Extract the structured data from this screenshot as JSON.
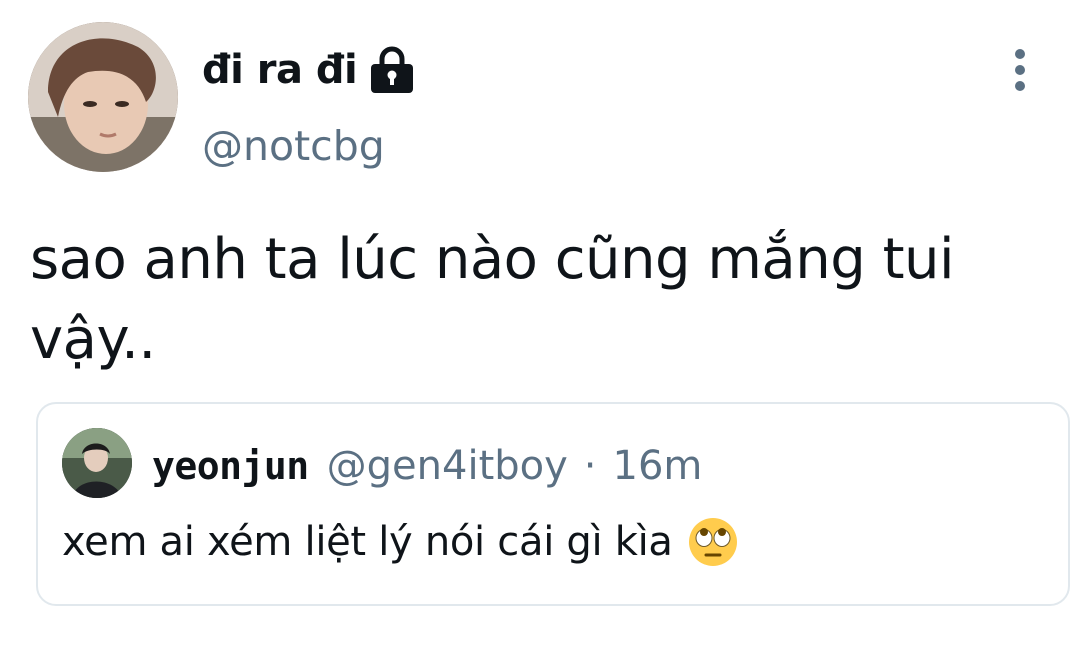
{
  "tweet": {
    "author": {
      "display_name": "đi ra đi",
      "handle": "@notcbg",
      "protected_icon": "lock-icon",
      "avatar_icon": "avatar"
    },
    "more_icon": "more-vertical-icon",
    "text": "sao anh ta lúc nào cũng mắng tui vậy..",
    "quote": {
      "display_name": "yeonjun",
      "handle": "@gen4itboy",
      "separator": "·",
      "time": "16m",
      "text": "xem ai xém liệt lý nói cái gì kìa",
      "emoji_icon": "face-with-rolling-eyes-icon"
    }
  },
  "colors": {
    "primary_text": "#0f1419",
    "secondary_text": "#5b7083",
    "card_border": "#e1e8ed",
    "emoji_yellow": "#ffcc4d"
  }
}
